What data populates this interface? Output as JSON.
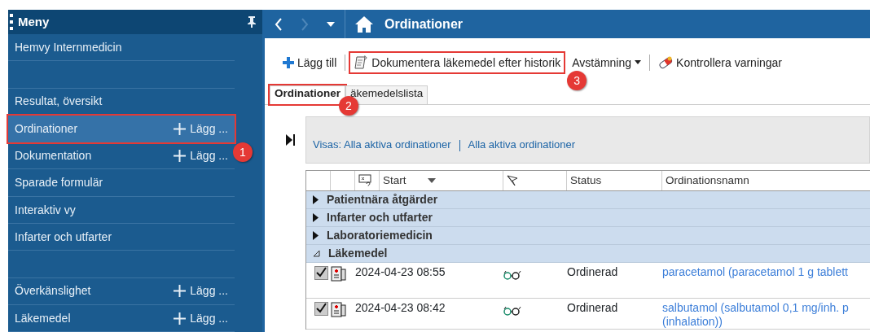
{
  "sidebar": {
    "title": "Meny",
    "items": [
      {
        "kind": "link",
        "label": "Hemvy Internmedicin",
        "selected": false
      },
      {
        "kind": "spacer"
      },
      {
        "kind": "link",
        "label": "Resultat, översikt",
        "selected": false
      },
      {
        "kind": "link",
        "label": "Ordinationer",
        "selected": true,
        "add_label": "Lägg ...",
        "callout": "1"
      },
      {
        "kind": "link",
        "label": "Dokumentation",
        "selected": false,
        "add_label": "Lägg ..."
      },
      {
        "kind": "link",
        "label": "Sparade formulär",
        "selected": false
      },
      {
        "kind": "link",
        "label": "Interaktiv vy",
        "selected": false
      },
      {
        "kind": "link",
        "label": "Infarter och utfarter",
        "selected": false
      },
      {
        "kind": "spacer"
      },
      {
        "kind": "link",
        "label": "Överkänslighet",
        "selected": false,
        "add_label": "Lägg ..."
      },
      {
        "kind": "link",
        "label": "Läkemedel",
        "selected": false,
        "add_label": "Lägg ..."
      }
    ]
  },
  "header": {
    "title": "Ordinationer"
  },
  "toolbar": [
    {
      "kind": "add",
      "label": "Lägg till"
    },
    {
      "kind": "document",
      "label": "Dokumentera läkemedel efter historik",
      "callout": "3"
    },
    {
      "kind": "dropdown",
      "label": "Avstämning"
    },
    {
      "kind": "warnings",
      "label": "Kontrollera varningar"
    }
  ],
  "tabs": [
    {
      "label": "Ordinationer",
      "selected": true,
      "callout": "2"
    },
    {
      "label": "äkemedelslista",
      "selected": false
    }
  ],
  "filter": {
    "label": "Visas: Alla aktiva ordinationer",
    "value": "Alla aktiva ordinationer"
  },
  "table": {
    "columns": [
      "Start",
      "Status",
      "Ordinationsnamn"
    ],
    "groups": [
      {
        "label": "Patientnära åtgärder",
        "expanded": false
      },
      {
        "label": "Infarter och utfarter",
        "expanded": false
      },
      {
        "label": "Laboratoriemedicin",
        "expanded": false
      },
      {
        "label": "Läkemedel",
        "expanded": true,
        "rows": [
          {
            "checked": true,
            "start": "2024-04-23 08:55",
            "status": "Ordinerad",
            "name": [
              "paracetamol (paracetamol 1 g tablett"
            ]
          },
          {
            "checked": true,
            "start": "2024-04-23 08:42",
            "status": "Ordinerad",
            "name": [
              "salbutamol (salbutamol 0,1 mg/inh. p",
              "(inhalation))"
            ]
          }
        ]
      }
    ]
  }
}
